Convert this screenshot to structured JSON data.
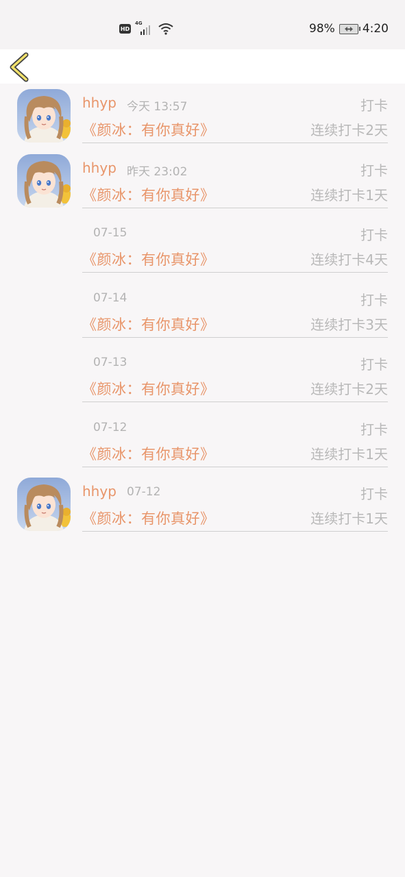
{
  "status_bar": {
    "hd": "HD",
    "network": "4G",
    "battery_percent": "98%",
    "time": "4:20"
  },
  "nav": {
    "back_icon": "chevron-left-icon"
  },
  "entries": [
    {
      "user": "hhyp",
      "time": "今天 13:57",
      "tag": "打卡",
      "book": "《颜冰：有你真好》",
      "streak": "连续打卡2天",
      "has_avatar": true
    },
    {
      "user": "hhyp",
      "time": "昨天 23:02",
      "tag": "打卡",
      "book": "《颜冰：有你真好》",
      "streak": "连续打卡1天",
      "has_avatar": true
    },
    {
      "user": "",
      "time": "07-15",
      "tag": "打卡",
      "book": "《颜冰：有你真好》",
      "streak": "连续打卡4天",
      "has_avatar": false
    },
    {
      "user": "",
      "time": "07-14",
      "tag": "打卡",
      "book": "《颜冰：有你真好》",
      "streak": "连续打卡3天",
      "has_avatar": false
    },
    {
      "user": "",
      "time": "07-13",
      "tag": "打卡",
      "book": "《颜冰：有你真好》",
      "streak": "连续打卡2天",
      "has_avatar": false
    },
    {
      "user": "",
      "time": "07-12",
      "tag": "打卡",
      "book": "《颜冰：有你真好》",
      "streak": "连续打卡1天",
      "has_avatar": false
    },
    {
      "user": "hhyp",
      "time": "07-12",
      "tag": "打卡",
      "book": "《颜冰：有你真好》",
      "streak": "连续打卡1天",
      "has_avatar": true
    }
  ],
  "colors": {
    "accent": "#e8956a",
    "muted": "#b8b8b8",
    "background": "#f8f6f7",
    "back_icon_fill": "#f0e06a"
  }
}
